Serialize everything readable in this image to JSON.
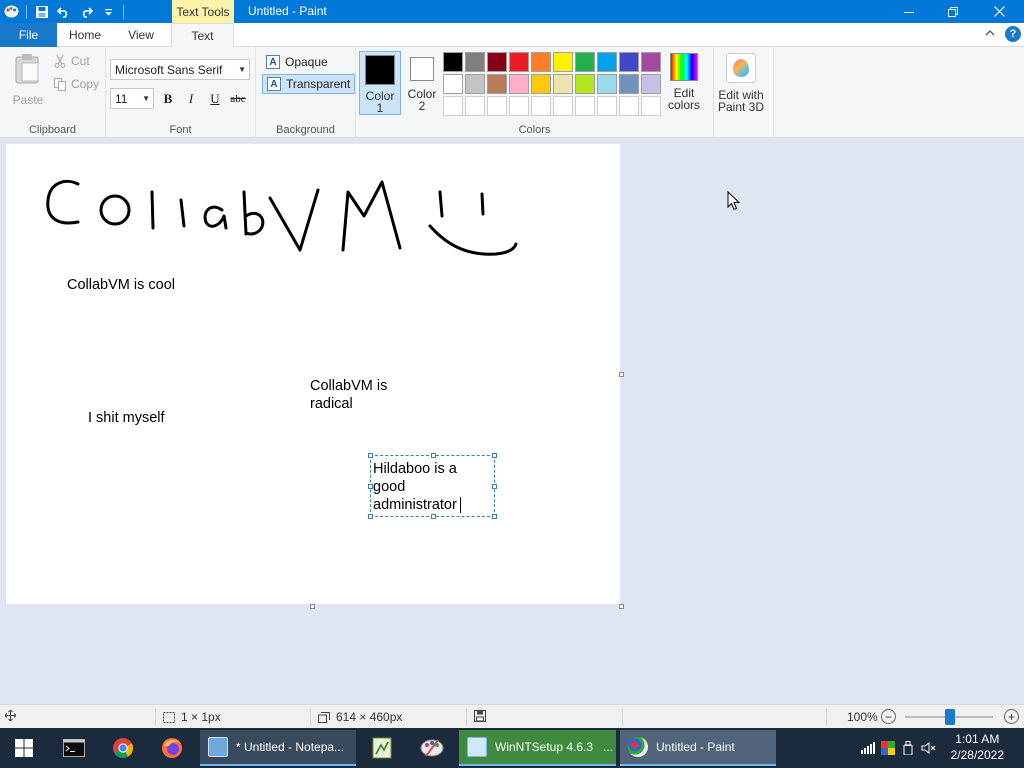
{
  "window": {
    "title": "Untitled - Paint",
    "context_tab": "Text Tools"
  },
  "ribbon_tabs": [
    {
      "label": "File"
    },
    {
      "label": "Home"
    },
    {
      "label": "View"
    },
    {
      "label": "Text"
    }
  ],
  "clipboard": {
    "paste": "Paste",
    "cut": "Cut",
    "copy": "Copy",
    "group": "Clipboard"
  },
  "font": {
    "family": "Microsoft Sans Serif",
    "size": "11",
    "bold": "B",
    "italic": "I",
    "underline": "U",
    "strike": "abc",
    "group": "Font"
  },
  "background": {
    "opaque": "Opaque",
    "transparent": "Transparent",
    "selected": "Transparent",
    "group": "Background"
  },
  "colors": {
    "color1_label_a": "Color",
    "color1_label_b": "1",
    "color2_label_a": "Color",
    "color2_label_b": "2",
    "color1": "#000000",
    "color2": "#ffffff",
    "edit_a": "Edit",
    "edit_b": "colors",
    "paint3d_a": "Edit with",
    "paint3d_b": "Paint 3D",
    "group": "Colors",
    "palette": [
      "#000000",
      "#7f7f7f",
      "#880015",
      "#ed1c24",
      "#ff7f27",
      "#fff200",
      "#22b14c",
      "#00a2e8",
      "#3f48cc",
      "#a349a4",
      "#ffffff",
      "#c3c3c3",
      "#b97a57",
      "#ffaec9",
      "#ffc90e",
      "#efe4b0",
      "#b5e61d",
      "#99d9ea",
      "#7092be",
      "#c8bfe7",
      "#ffffff",
      "#ffffff",
      "#ffffff",
      "#ffffff",
      "#ffffff",
      "#ffffff",
      "#ffffff",
      "#ffffff",
      "#ffffff",
      "#ffffff"
    ]
  },
  "canvas": {
    "texts": [
      "CollabVM is cool",
      "CollabVM is\nradical",
      "I shit myself",
      "Hildaboo is a\ngood\nadministrator"
    ]
  },
  "status": {
    "cursor_pos": "",
    "selection_size": "1 × 1px",
    "canvas_size": "614 × 460px",
    "zoom": "100%"
  },
  "taskbar": {
    "tasks": [
      {
        "label": "* Untitled - Notepa..."
      },
      {
        "label": "WinNTSetup 4.6.3"
      },
      {
        "label": "Untitled - Paint"
      }
    ],
    "time": "1:01 AM",
    "date": "2/28/2022"
  }
}
